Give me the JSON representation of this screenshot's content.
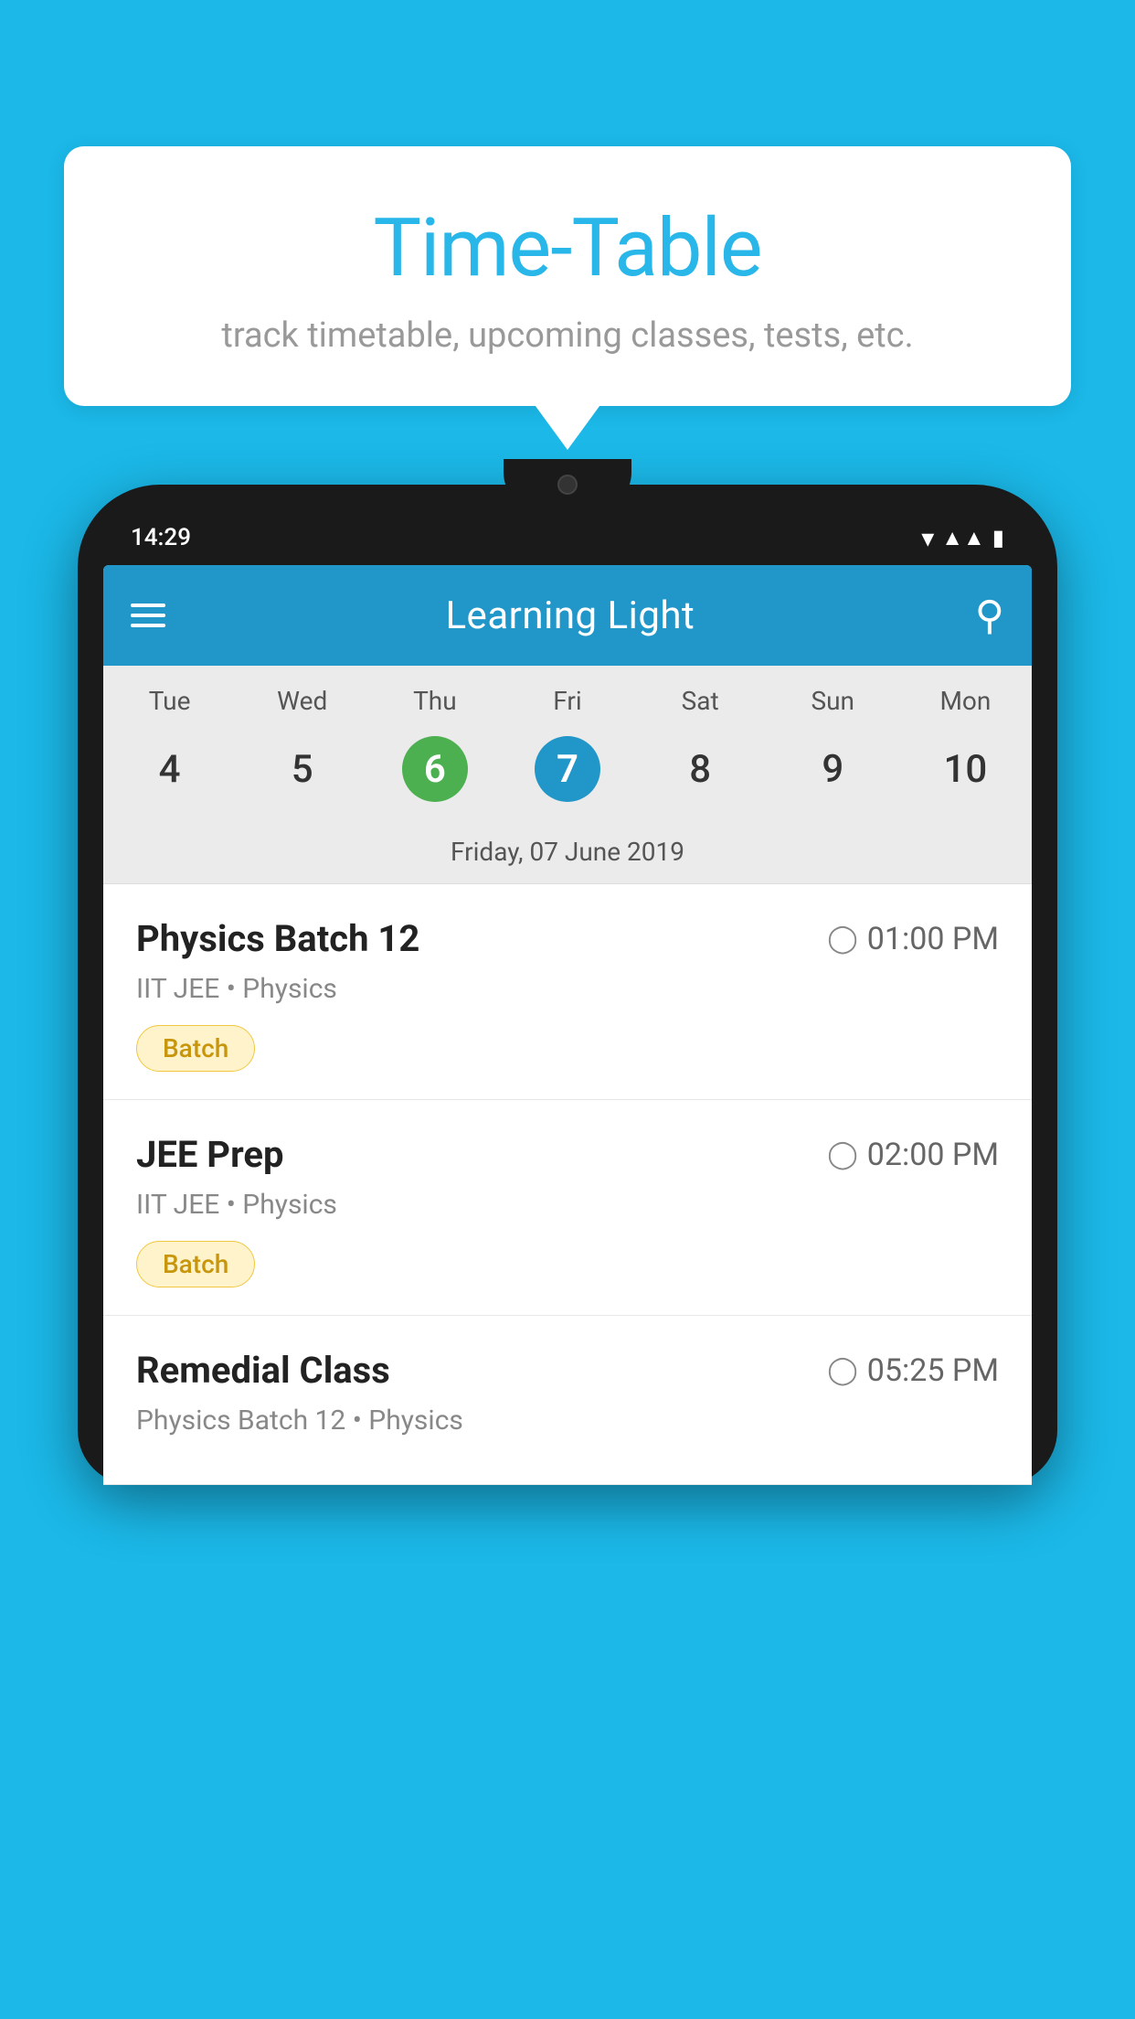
{
  "background_color": "#1BB8E8",
  "bubble": {
    "title": "Time-Table",
    "subtitle": "track timetable, upcoming classes, tests, etc."
  },
  "phone": {
    "status_bar": {
      "time": "14:29"
    },
    "app_bar": {
      "title": "Learning Light"
    },
    "calendar": {
      "days": [
        {
          "label": "Tue",
          "number": "4"
        },
        {
          "label": "Wed",
          "number": "5"
        },
        {
          "label": "Thu",
          "number": "6",
          "style": "green"
        },
        {
          "label": "Fri",
          "number": "7",
          "style": "blue"
        },
        {
          "label": "Sat",
          "number": "8"
        },
        {
          "label": "Sun",
          "number": "9"
        },
        {
          "label": "Mon",
          "number": "10"
        }
      ],
      "selected_date_label": "Friday, 07 June 2019"
    },
    "schedule": [
      {
        "name": "Physics Batch 12",
        "time": "01:00 PM",
        "meta": "IIT JEE • Physics",
        "tag": "Batch"
      },
      {
        "name": "JEE Prep",
        "time": "02:00 PM",
        "meta": "IIT JEE • Physics",
        "tag": "Batch"
      },
      {
        "name": "Remedial Class",
        "time": "05:25 PM",
        "meta": "Physics Batch 12 • Physics",
        "tag": null
      }
    ]
  }
}
